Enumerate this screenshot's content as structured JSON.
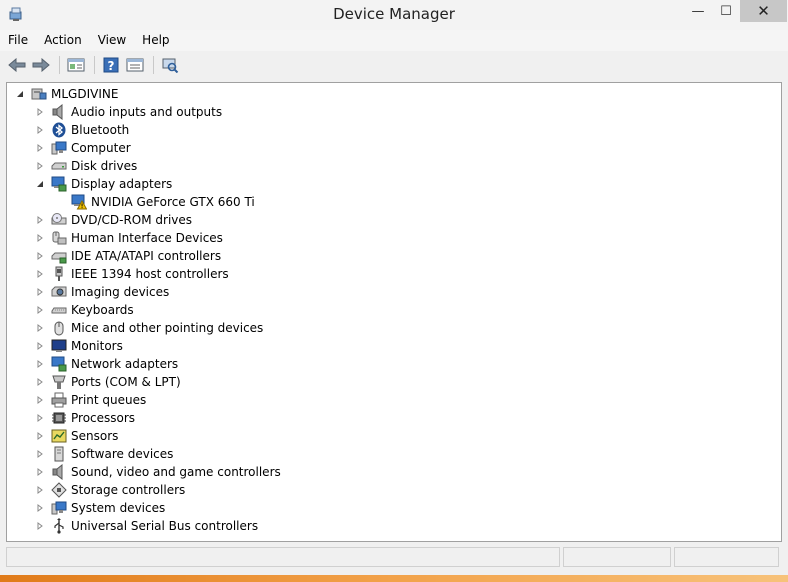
{
  "window": {
    "title": "Device Manager",
    "app_icon": "device-manager-icon"
  },
  "window_controls": {
    "minimize": "—",
    "maximize": "☐",
    "close": "✕"
  },
  "menu": [
    "File",
    "Action",
    "View",
    "Help"
  ],
  "toolbar": [
    "back-icon",
    "forward-icon",
    "properties-icon",
    "help-icon",
    "show-hide-pane-icon",
    "scan-hardware-icon"
  ],
  "tree": {
    "root": {
      "label": "MLGDIVINE",
      "icon": "computer-icon",
      "expanded": true
    },
    "categories": [
      {
        "label": "Audio inputs and outputs",
        "icon": "speaker-icon",
        "expanded": false
      },
      {
        "label": "Bluetooth",
        "icon": "bluetooth-icon",
        "expanded": false
      },
      {
        "label": "Computer",
        "icon": "computer-icon",
        "expanded": false
      },
      {
        "label": "Disk drives",
        "icon": "disk-drive-icon",
        "expanded": false
      },
      {
        "label": "Display adapters",
        "icon": "display-adapter-icon",
        "expanded": true,
        "children": [
          {
            "label": "NVIDIA GeForce GTX 660 Ti",
            "icon": "display-adapter-warning-icon",
            "warning": true
          }
        ]
      },
      {
        "label": "DVD/CD-ROM drives",
        "icon": "dvd-drive-icon",
        "expanded": false
      },
      {
        "label": "Human Interface Devices",
        "icon": "hid-icon",
        "expanded": false
      },
      {
        "label": "IDE ATA/ATAPI controllers",
        "icon": "ide-controller-icon",
        "expanded": false
      },
      {
        "label": "IEEE 1394 host controllers",
        "icon": "firewire-icon",
        "expanded": false
      },
      {
        "label": "Imaging devices",
        "icon": "camera-icon",
        "expanded": false
      },
      {
        "label": "Keyboards",
        "icon": "keyboard-icon",
        "expanded": false
      },
      {
        "label": "Mice and other pointing devices",
        "icon": "mouse-icon",
        "expanded": false
      },
      {
        "label": "Monitors",
        "icon": "monitor-icon",
        "expanded": false
      },
      {
        "label": "Network adapters",
        "icon": "network-adapter-icon",
        "expanded": false
      },
      {
        "label": "Ports (COM & LPT)",
        "icon": "port-icon",
        "expanded": false
      },
      {
        "label": "Print queues",
        "icon": "printer-icon",
        "expanded": false
      },
      {
        "label": "Processors",
        "icon": "processor-icon",
        "expanded": false
      },
      {
        "label": "Sensors",
        "icon": "sensor-icon",
        "expanded": false
      },
      {
        "label": "Software devices",
        "icon": "software-device-icon",
        "expanded": false
      },
      {
        "label": "Sound, video and game controllers",
        "icon": "speaker-icon",
        "expanded": false
      },
      {
        "label": "Storage controllers",
        "icon": "storage-controller-icon",
        "expanded": false
      },
      {
        "label": "System devices",
        "icon": "system-device-icon",
        "expanded": false
      },
      {
        "label": "Universal Serial Bus controllers",
        "icon": "usb-icon",
        "expanded": false
      }
    ]
  },
  "colors": {
    "accent": "#1e73be",
    "warning": "#f2c200",
    "close_button": "#c7c7c7",
    "taskbar": "#e07b1a"
  }
}
